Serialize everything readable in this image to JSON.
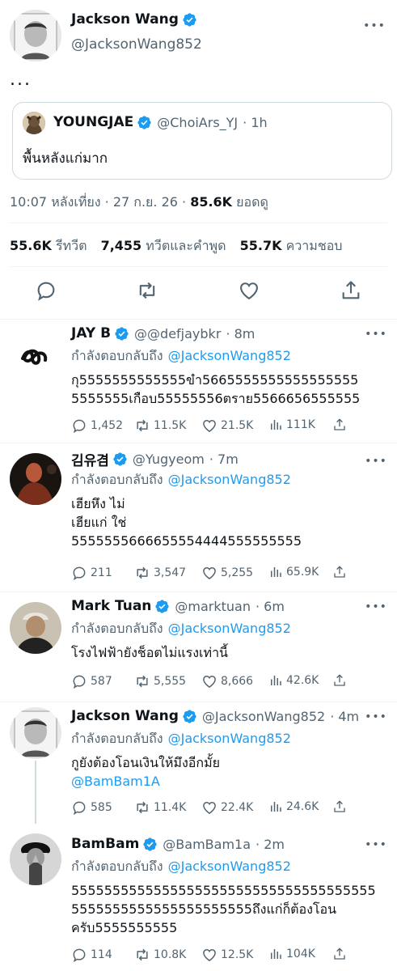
{
  "main": {
    "name": "Jackson Wang",
    "handle": "@JacksonWang852",
    "text": "...",
    "quote": {
      "name": "YOUNGJAE",
      "handle": "@ChoiArs_YJ",
      "time": "· 1h",
      "text": "พื้นหลังแก่มาก"
    },
    "timestamp": "10:07 หลังเที่ยง · 27 ก.ย. 26 · ",
    "views_count": "85.6K",
    "views_label": " ยอดดู",
    "retweets_count": "55.6K",
    "retweets_label": "รีทวีต",
    "quotes_count": "7,455",
    "quotes_label": "ทวีตและคำพูด",
    "likes_count": "55.7K",
    "likes_label": "ความชอบ"
  },
  "replying_label": "กำลังตอบกลับถึง",
  "replies": [
    {
      "name": "JAY B",
      "handle": "@@defjaybkr",
      "time": "· 8m",
      "replying_to": "@JacksonWang852",
      "text": "กุ5555555555555ขำ5665555555555555555\n5555555เกือบ55555556ตราย5566656555555",
      "replies": "1,452",
      "retweets": "11.5K",
      "likes": "21.5K",
      "views": "111K"
    },
    {
      "name": "김유겸",
      "handle": "@Yugyeom",
      "time": "· 7m",
      "replying_to": "@JacksonWang852",
      "text": "เฮียหึง  ไม่\nเฮียแก่  ใช่\n5555555666655554444555555555",
      "replies": "211",
      "retweets": "3,547",
      "likes": "5,255",
      "views": "65.9K"
    },
    {
      "name": "Mark Tuan",
      "handle": "@marktuan",
      "time": "· 6m",
      "replying_to": "@JacksonWang852",
      "text": "โรงไฟฟ้ายังช็อตไม่แรงเท่านี้",
      "replies": "587",
      "retweets": "5,555",
      "likes": "8,666",
      "views": "42.6K"
    },
    {
      "name": "Jackson Wang",
      "handle": "@JacksonWang852",
      "time": "· 4m",
      "replying_to": "@JacksonWang852",
      "text": "กูยังต้องโอนเงินให้มึงอีกมั้ย",
      "mention": "@BamBam1A",
      "replies": "585",
      "retweets": "11.4K",
      "likes": "22.4K",
      "views": "24.6K"
    },
    {
      "name": "BamBam",
      "handle": "@BamBam1a",
      "time": "· 2m",
      "replying_to": "@JacksonWang852",
      "text": "5555555555555555555555555555555555555\n5555555555555555555555ถึงแก่ก็ต้องโอน\nครับ5555555555",
      "replies": "114",
      "retweets": "10.8K",
      "likes": "12.5K",
      "views": "104K"
    }
  ],
  "colors": {
    "link": "#1d9bf0",
    "verified": "#1d9bf0",
    "muted": "#536471",
    "divider": "#eff3f4"
  },
  "icons": [
    "verified-badge-icon",
    "more-icon",
    "reply-icon",
    "retweet-icon",
    "like-icon",
    "share-icon",
    "views-icon"
  ]
}
